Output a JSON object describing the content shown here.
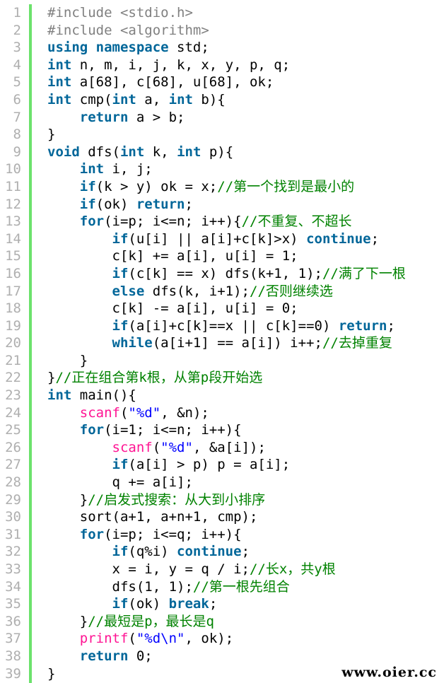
{
  "watermark": "www.oier.cc",
  "lines": [
    {
      "n": "1",
      "code": "#include <stdio.h>"
    },
    {
      "n": "2",
      "code": "#include <algorithm>"
    },
    {
      "n": "3",
      "code": "using namespace std;"
    },
    {
      "n": "4",
      "code": "int n, m, i, j, k, x, y, p, q;"
    },
    {
      "n": "5",
      "code": "int a[68], c[68], u[68], ok;"
    },
    {
      "n": "6",
      "code": "int cmp(int a, int b){"
    },
    {
      "n": "7",
      "code": "    return a > b;"
    },
    {
      "n": "8",
      "code": "}"
    },
    {
      "n": "9",
      "code": "void dfs(int k, int p){"
    },
    {
      "n": "10",
      "code": "    int i, j;"
    },
    {
      "n": "11",
      "code": "    if(k > y) ok = x;//第一个找到是最小的"
    },
    {
      "n": "12",
      "code": "    if(ok) return;"
    },
    {
      "n": "13",
      "code": "    for(i=p; i<=n; i++){//不重复、不超长"
    },
    {
      "n": "14",
      "code": "        if(u[i] || a[i]+c[k]>x) continue;"
    },
    {
      "n": "15",
      "code": "        c[k] += a[i], u[i] = 1;"
    },
    {
      "n": "16",
      "code": "        if(c[k] == x) dfs(k+1, 1);//满了下一根"
    },
    {
      "n": "17",
      "code": "        else dfs(k, i+1);//否则继续选"
    },
    {
      "n": "18",
      "code": "        c[k] -= a[i], u[i] = 0;"
    },
    {
      "n": "19",
      "code": "        if(a[i]+c[k]==x || c[k]==0) return;"
    },
    {
      "n": "20",
      "code": "        while(a[i+1] == a[i]) i++;//去掉重复"
    },
    {
      "n": "21",
      "code": "    }"
    },
    {
      "n": "22",
      "code": "}//正在组合第k根，从第p段开始选"
    },
    {
      "n": "23",
      "code": "int main(){"
    },
    {
      "n": "24",
      "code": "    scanf(\"%d\", &n);"
    },
    {
      "n": "25",
      "code": "    for(i=1; i<=n; i++){"
    },
    {
      "n": "26",
      "code": "        scanf(\"%d\", &a[i]);"
    },
    {
      "n": "27",
      "code": "        if(a[i] > p) p = a[i];"
    },
    {
      "n": "28",
      "code": "        q += a[i];"
    },
    {
      "n": "29",
      "code": "    }//启发式搜索：从大到小排序"
    },
    {
      "n": "30",
      "code": "    sort(a+1, a+n+1, cmp);"
    },
    {
      "n": "31",
      "code": "    for(i=p; i<=q; i++){"
    },
    {
      "n": "32",
      "code": "        if(q%i) continue;"
    },
    {
      "n": "33",
      "code": "        x = i, y = q / i;//长x，共y根"
    },
    {
      "n": "34",
      "code": "        dfs(1, 1);//第一根先组合"
    },
    {
      "n": "35",
      "code": "        if(ok) break;"
    },
    {
      "n": "36",
      "code": "    }//最短是p，最长是q"
    },
    {
      "n": "37",
      "code": "    printf(\"%d\\n\", ok);"
    },
    {
      "n": "38",
      "code": "    return 0;"
    },
    {
      "n": "39",
      "code": "}"
    }
  ]
}
